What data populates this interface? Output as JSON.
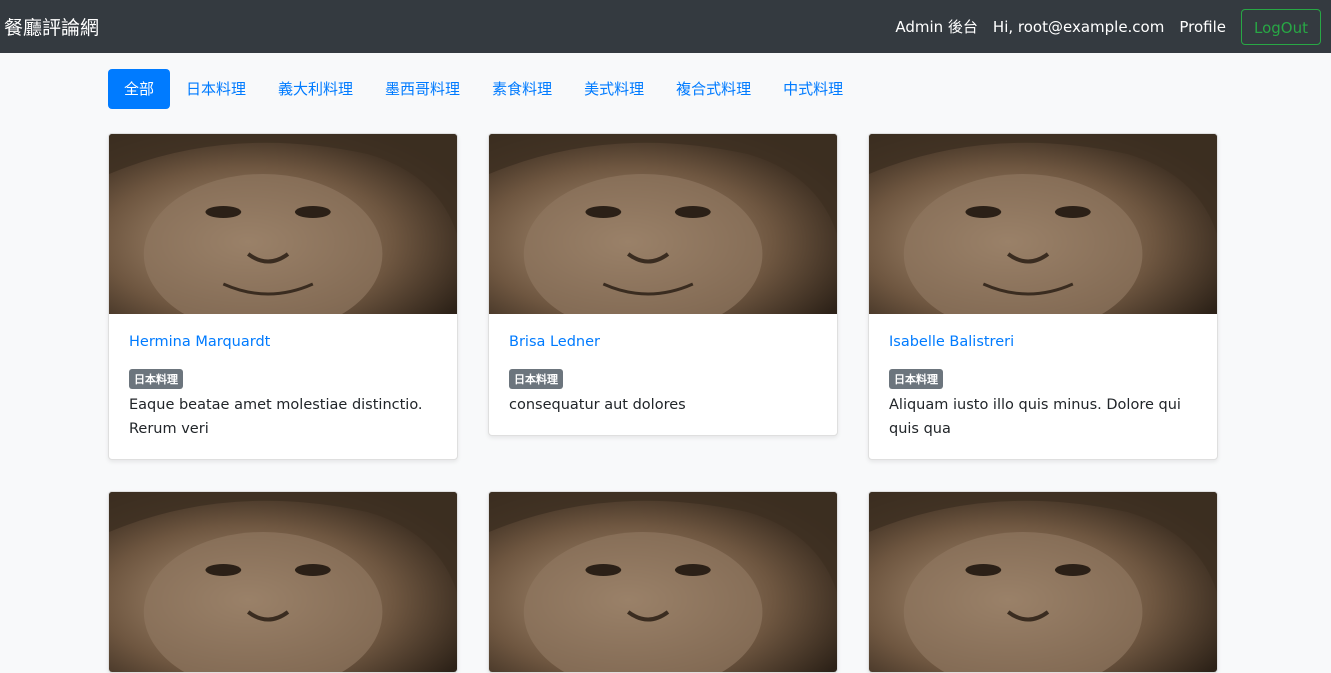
{
  "navbar": {
    "brand": "餐廳評論網",
    "admin_link": "Admin 後台",
    "greeting": "Hi, root@example.com",
    "profile_link": "Profile",
    "logout_label": "LogOut"
  },
  "tabs": [
    {
      "label": "全部",
      "active": true
    },
    {
      "label": "日本料理",
      "active": false
    },
    {
      "label": "義大利料理",
      "active": false
    },
    {
      "label": "墨西哥料理",
      "active": false
    },
    {
      "label": "素食料理",
      "active": false
    },
    {
      "label": "美式料理",
      "active": false
    },
    {
      "label": "複合式料理",
      "active": false
    },
    {
      "label": "中式料理",
      "active": false
    }
  ],
  "cards": [
    {
      "name": "Hermina Marquardt",
      "category": "日本料理",
      "description": "Eaque beatae amet molestiae distinctio. Rerum veri"
    },
    {
      "name": "Brisa Ledner",
      "category": "日本料理",
      "description": "consequatur aut dolores"
    },
    {
      "name": "Isabelle Balistreri",
      "category": "日本料理",
      "description": "Aliquam iusto illo quis minus. Dolore qui quis qua"
    },
    {
      "name": "",
      "category": "",
      "description": ""
    },
    {
      "name": "",
      "category": "",
      "description": ""
    },
    {
      "name": "",
      "category": "",
      "description": ""
    }
  ],
  "colors": {
    "navbar_bg": "#343a40",
    "primary": "#007bff",
    "success": "#28a745",
    "badge": "#6c757d",
    "page_bg": "#f8f9fa"
  },
  "icons": {
    "card_image": "photo-placeholder-icon"
  }
}
